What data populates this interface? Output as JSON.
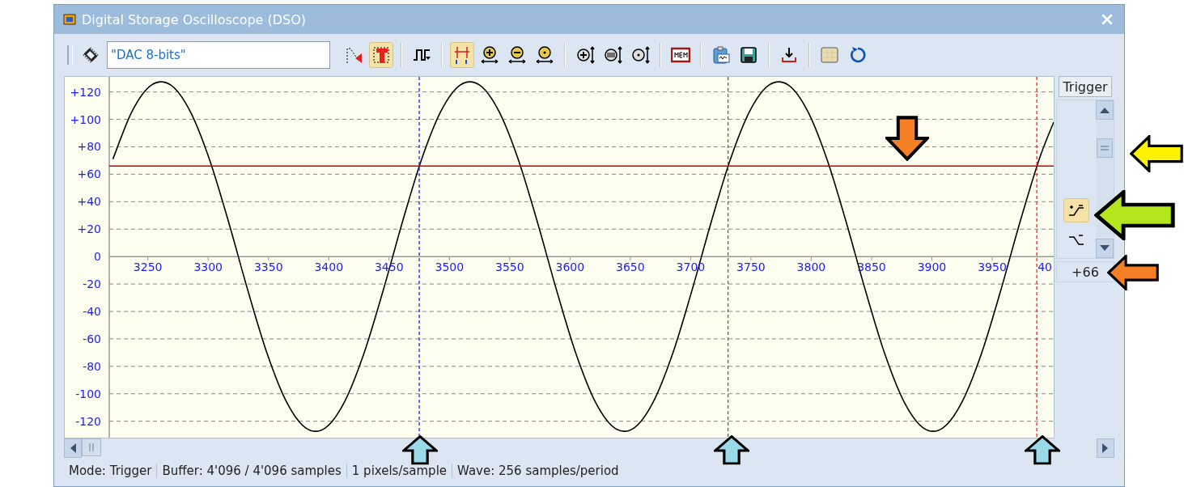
{
  "window": {
    "title": "Digital Storage Oscilloscope (DSO)"
  },
  "toolbar": {
    "source": {
      "value": "\"DAC 8-bits\""
    },
    "groups": [
      [
        {
          "kind": "trigger-marker",
          "pressed": false
        },
        {
          "kind": "trigger",
          "pressed": true
        }
      ],
      [
        {
          "kind": "pulse",
          "pressed": false
        }
      ],
      [
        {
          "kind": "cursors",
          "pressed": true
        },
        {
          "kind": "h-zoom-in",
          "pressed": false
        },
        {
          "kind": "h-zoom-out",
          "pressed": false
        },
        {
          "kind": "h-zoom-reset",
          "pressed": false
        }
      ],
      [
        {
          "kind": "v-zoom-in",
          "pressed": false
        },
        {
          "kind": "v-zoom-all",
          "pressed": false
        },
        {
          "kind": "v-zoom-reset",
          "pressed": false
        }
      ],
      [
        {
          "kind": "memory",
          "pressed": false
        }
      ],
      [
        {
          "kind": "copy",
          "pressed": false
        },
        {
          "kind": "save",
          "pressed": false
        }
      ],
      [
        {
          "kind": "export",
          "pressed": false
        }
      ],
      [
        {
          "kind": "grid",
          "pressed": false
        },
        {
          "kind": "reset",
          "pressed": false
        }
      ]
    ]
  },
  "plot": {
    "cut_tick_label": "40",
    "chart_data": {
      "type": "line",
      "x": [
        3221,
        3237,
        3253,
        3269,
        3285,
        3301,
        3317,
        3333,
        3349,
        3365,
        3381,
        3397,
        3413,
        3429,
        3445,
        3461,
        3477,
        3493,
        3509,
        3525,
        3541,
        3557,
        3573,
        3589,
        3605,
        3621,
        3637,
        3653,
        3669,
        3685,
        3701,
        3717,
        3733,
        3749,
        3765,
        3781,
        3797,
        3813,
        3829,
        3845,
        3861,
        3877,
        3893,
        3909,
        3925,
        3941,
        3957,
        3973,
        3989,
        4001
      ],
      "series": [
        {
          "color": "#000000",
          "values": [
            71,
            106,
            125,
            125,
            106,
            71,
            25,
            -25,
            -71,
            -106,
            -125,
            -125,
            -106,
            -71,
            -25,
            25,
            71,
            106,
            125,
            125,
            106,
            71,
            25,
            -25,
            -71,
            -106,
            -125,
            -125,
            -106,
            -71,
            -25,
            25,
            71,
            106,
            125,
            125,
            106,
            71,
            25,
            -25,
            -71,
            -106,
            -125,
            -125,
            -106,
            -71,
            -25,
            25,
            71,
            98
          ]
        }
      ],
      "xlim": [
        3218,
        4001
      ],
      "ylim": [
        -132,
        131
      ],
      "grid": true,
      "xticks": [
        3250,
        3300,
        3350,
        3400,
        3450,
        3500,
        3550,
        3600,
        3650,
        3700,
        3750,
        3800,
        3850,
        3900,
        3950
      ],
      "yticks": [
        {
          "value": 120,
          "label": "+120"
        },
        {
          "value": 100,
          "label": "+100"
        },
        {
          "value": 80,
          "label": "+80"
        },
        {
          "value": 60,
          "label": "+60"
        },
        {
          "value": 40,
          "label": "+40"
        },
        {
          "value": 20,
          "label": "+20"
        },
        {
          "value": 0,
          "label": "0"
        },
        {
          "value": -20,
          "label": "-20"
        },
        {
          "value": -40,
          "label": "-40"
        },
        {
          "value": -60,
          "label": "-60"
        },
        {
          "value": -80,
          "label": "-80"
        },
        {
          "value": -100,
          "label": "-100"
        },
        {
          "value": -120,
          "label": "-120"
        }
      ],
      "ref_lines": [
        {
          "axis": "y",
          "value": 66,
          "color": "#d00000"
        },
        {
          "axis": "x",
          "value": 3475,
          "color": "#2020ff"
        },
        {
          "axis": "x",
          "value": 3731,
          "color": "#209020"
        },
        {
          "axis": "x",
          "value": 3987,
          "color": "#ff2020"
        }
      ]
    }
  },
  "trigger_panel": {
    "title": "Trigger",
    "level": 0.76,
    "edges": [
      {
        "kind": "rising",
        "selected": true
      },
      {
        "kind": "falling",
        "selected": false
      }
    ],
    "value": "+66"
  },
  "status_bar": [
    "Mode: Trigger",
    "Buffer:  4'096 / 4'096 samples",
    "1 pixels/sample",
    "Wave: 256 samples/period"
  ]
}
